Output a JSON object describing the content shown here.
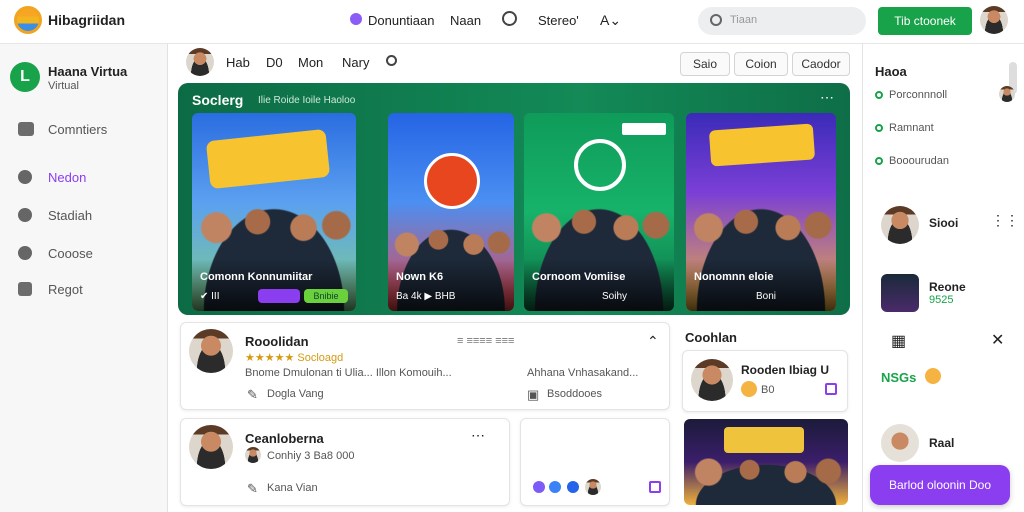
{
  "header": {
    "app_name": "Hibagriidan",
    "nav": [
      "Donuntiaan",
      "Naan",
      "Stereo'"
    ],
    "search_placeholder": "Tiaan",
    "cta_label": "Tib ctoonek"
  },
  "sidebar": {
    "profile_name": "Haana Virtua",
    "profile_sub": "Virtual",
    "items": [
      {
        "label": "Comntiers",
        "active": false
      },
      {
        "label": "Nedon",
        "active": true
      },
      {
        "label": "Stadiah",
        "active": false
      },
      {
        "label": "Cooose",
        "active": false
      },
      {
        "label": "Regot",
        "active": false
      }
    ]
  },
  "feed_toolbar": {
    "tabs": [
      "Hab",
      "D0",
      "Mon",
      "Nary"
    ],
    "buttons": [
      "Saio",
      "Coion",
      "Caodor"
    ]
  },
  "banner": {
    "title": "Soclerg",
    "subtitle": "Ilie Roide Ioile Haoloo",
    "cards": [
      {
        "title": "Comonn Konnumiitar",
        "meta": "✔ III",
        "chip1": "",
        "chip2": "Bnibie"
      },
      {
        "title": "Nown K6",
        "meta": "Ba 4k ▶ BHB",
        "chip1": "",
        "chip2": ""
      },
      {
        "title": "Cornoom Vomiise",
        "meta": "Soihy",
        "chip1": "",
        "chip2": ""
      },
      {
        "title": "Nonomnn eloie",
        "meta": "Boni",
        "chip1": "",
        "chip2": ""
      }
    ],
    "accent_colors": [
      "#0c6b45",
      "#138a57"
    ]
  },
  "posts": [
    {
      "author": "Rooolidan",
      "rating_text": "★★★★★ Socloagd",
      "body": "Bnome Dmulonan ti Ulia... Illon Komouih...",
      "aside": "Ahhana Vnhasakand...",
      "action_left": "Dogla Vang",
      "action_right": "Bsoddooes"
    },
    {
      "author": "Ceanloberna",
      "meta": "Conhiy 3 Ba8 000",
      "action_left": "Kana Vian"
    }
  ],
  "right_feed": {
    "title": "Coohlan",
    "item_title": "Rooden Ibiag U",
    "item_meta": "B0"
  },
  "rightbar": {
    "title": "Haoa",
    "links": [
      "Porconnnoll",
      "Ramnant",
      "Booourudan"
    ],
    "users": [
      {
        "name": "Siooi"
      },
      {
        "name": "Reone",
        "sub": "9525"
      },
      {
        "name": "Raal"
      }
    ],
    "nsgs_label": "NSGs"
  },
  "floating_button": "Barlod oloonin Doo"
}
